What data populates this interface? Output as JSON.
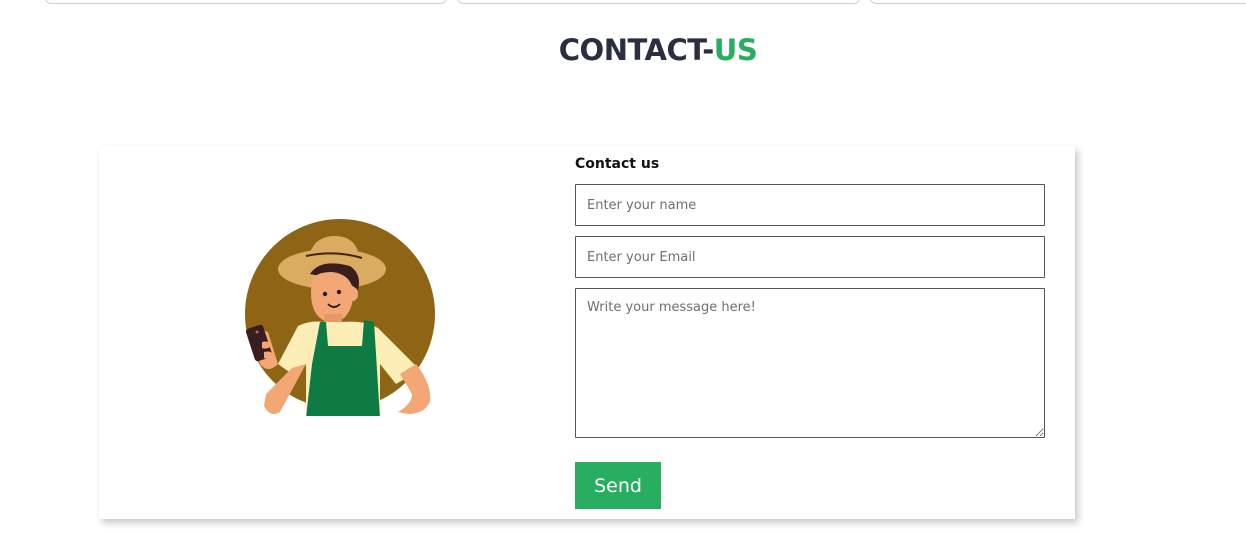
{
  "page_title": {
    "main": "CONTACT-",
    "accent": "US"
  },
  "colors": {
    "title_dark": "#2b2d42",
    "accent_green": "#27ae60",
    "illustration_circle": "#8e6514",
    "apron_green": "#0e7a44"
  },
  "contact_form": {
    "heading": "Contact us",
    "name_placeholder": "Enter your name",
    "email_placeholder": "Enter your Email",
    "message_placeholder": "Write your message here!",
    "send_label": "Send"
  },
  "illustration": {
    "icon": "farmer-with-phone-illustration"
  }
}
